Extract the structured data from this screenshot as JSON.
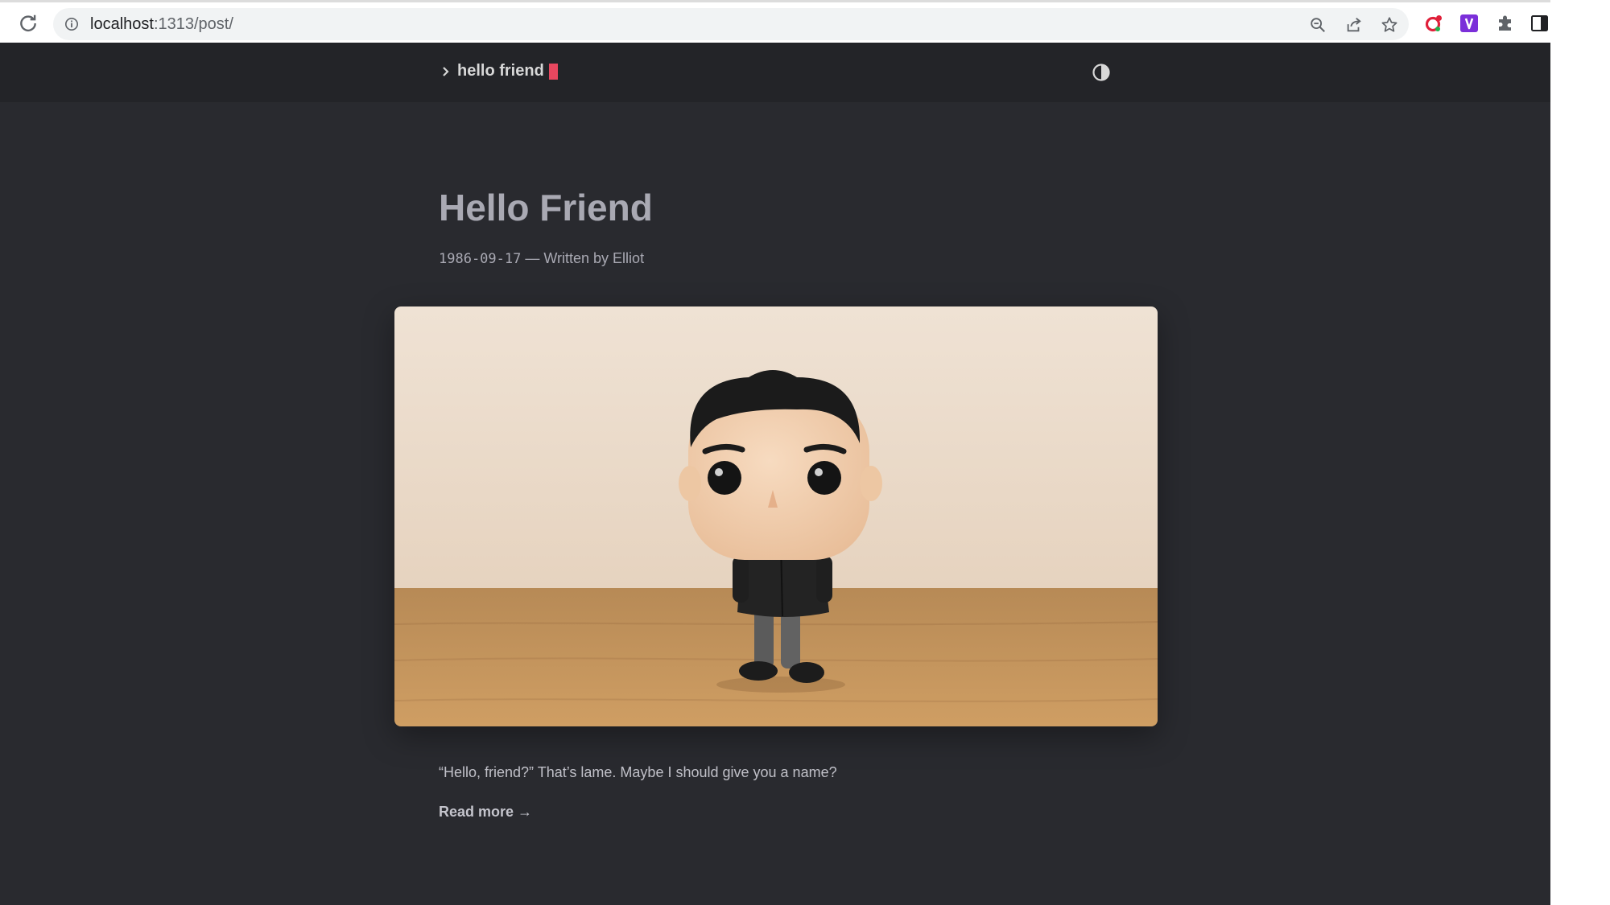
{
  "browser": {
    "url_host": "localhost",
    "url_path": ":1313/post/",
    "icons": [
      "reload-icon",
      "site-info-icon",
      "zoom-out-icon",
      "share-icon",
      "bookmark-star-icon",
      "opera-extension-icon",
      "v-extension-icon",
      "extensions-puzzle-icon",
      "side-panel-icon"
    ]
  },
  "site": {
    "logo_text": "hello friend",
    "accent_color": "#e8475f",
    "theme_toggle_icon": "contrast-icon"
  },
  "post": {
    "title": "Hello Friend",
    "date": "1986-09-17",
    "byline": " — Written by Elliot",
    "cover_image": "figurine-photo",
    "excerpt": "“Hello, friend?” That’s lame. Maybe I should give you a name?",
    "read_more": "Read more →"
  }
}
